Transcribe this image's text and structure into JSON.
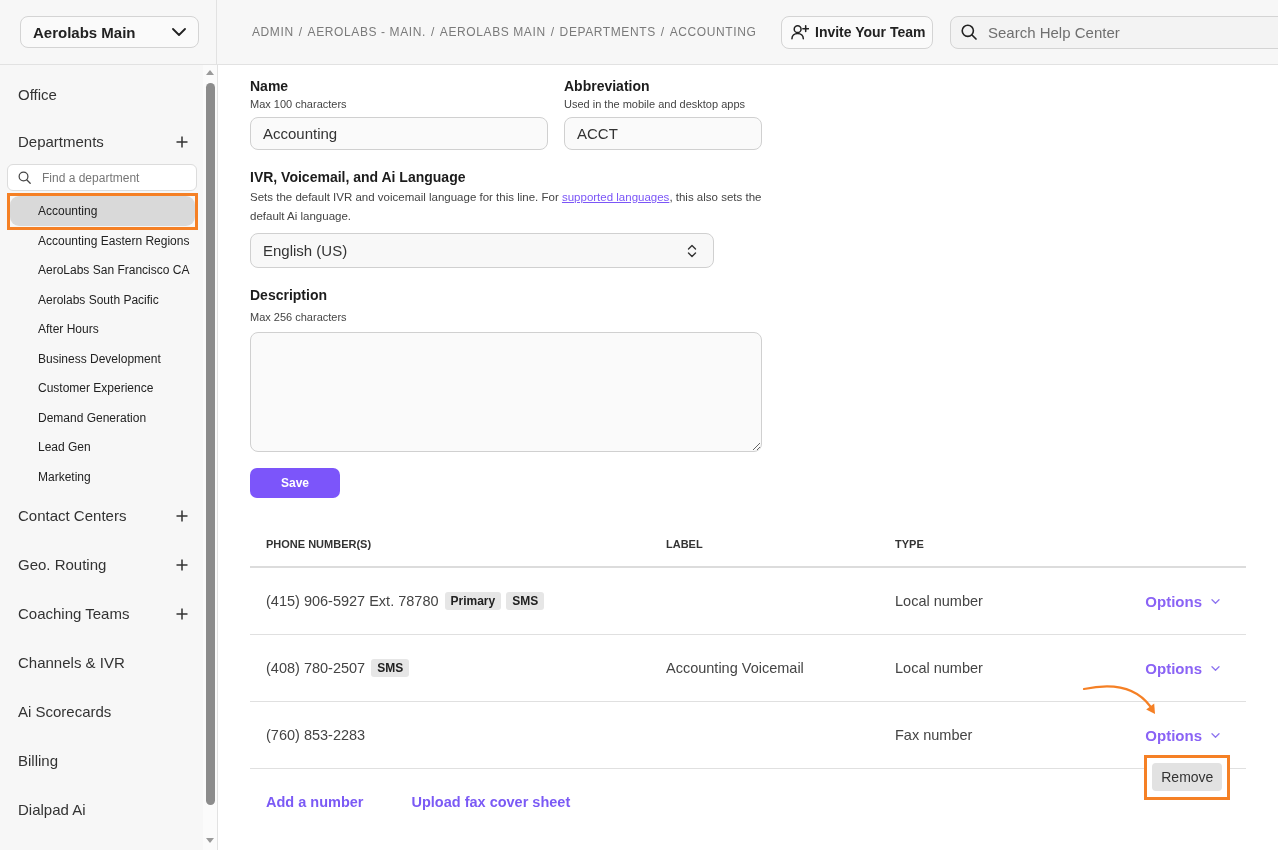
{
  "top_bar": {
    "org_switcher": "Aerolabs Main",
    "breadcrumb": [
      "ADMIN",
      "AEROLABS - MAIN.",
      "AEROLABS MAIN",
      "DEPARTMENTS",
      "ACCOUNTING"
    ],
    "breadcrumb_separator": "/",
    "invite_button": "Invite Your Team",
    "search": {
      "placeholder": "Search Help Center"
    }
  },
  "sidebar": {
    "sections": [
      {
        "label": "Office",
        "add_button": false
      },
      {
        "label": "Departments",
        "add_button": true,
        "search": {
          "placeholder": "Find a department"
        },
        "children": [
          {
            "label": "Accounting",
            "selected": true,
            "highlighted": true
          },
          {
            "label": "Accounting Eastern Regions",
            "selected": false,
            "highlighted": false
          },
          {
            "label": "AeroLabs San Francisco CA",
            "selected": false,
            "highlighted": false
          },
          {
            "label": "Aerolabs South Pacific",
            "selected": false,
            "highlighted": false
          },
          {
            "label": "After Hours",
            "selected": false,
            "highlighted": false
          },
          {
            "label": "Business Development",
            "selected": false,
            "highlighted": false
          },
          {
            "label": "Customer Experience",
            "selected": false,
            "highlighted": false
          },
          {
            "label": "Demand Generation",
            "selected": false,
            "highlighted": false
          },
          {
            "label": "Lead Gen",
            "selected": false,
            "highlighted": false
          },
          {
            "label": "Marketing",
            "selected": false,
            "highlighted": false
          }
        ]
      },
      {
        "label": "Contact Centers",
        "add_button": true
      },
      {
        "label": "Geo. Routing",
        "add_button": true
      },
      {
        "label": "Coaching Teams",
        "add_button": true
      },
      {
        "label": "Channels & IVR",
        "add_button": false
      },
      {
        "label": "Ai Scorecards",
        "add_button": false
      },
      {
        "label": "Billing",
        "add_button": false
      },
      {
        "label": "Dialpad Ai",
        "add_button": false
      }
    ]
  },
  "form": {
    "name": {
      "label": "Name",
      "hint": "Max 100 characters",
      "value": "Accounting"
    },
    "abbreviation": {
      "label": "Abbreviation",
      "hint": "Used in the mobile and desktop apps",
      "value": "ACCT"
    },
    "language": {
      "label": "IVR, Voicemail, and Ai Language",
      "description_before": "Sets the default IVR and voicemail language for this line. For ",
      "description_link": "supported languages",
      "description_after": ", this also sets the default Ai language.",
      "value": "English (US)"
    },
    "description": {
      "label": "Description",
      "hint": "Max 256 characters"
    },
    "save_button": "Save"
  },
  "table": {
    "columns": [
      "PHONE NUMBER(S)",
      "LABEL",
      "TYPE"
    ],
    "rows": [
      {
        "number": "(415) 906-5927 Ext. 78780",
        "badges": [
          "Primary",
          "SMS"
        ],
        "type": "Local number",
        "options": "Options",
        "options_open": false,
        "callout_arrow": false
      },
      {
        "number": "(408) 780-2507",
        "badges": [
          "SMS"
        ],
        "label": "Accounting Voicemail",
        "type": "Local number",
        "options": "Options",
        "options_open": false,
        "callout_arrow": false
      },
      {
        "number": "(760) 853-2283",
        "badges": [],
        "type": "Fax number",
        "options": "Options",
        "options_open": true,
        "callout_arrow": true
      }
    ],
    "options_menu": [
      {
        "label": "Remove",
        "highlighted": true
      }
    ],
    "footer_links": [
      "Add a number",
      "Upload fax cover sheet"
    ]
  }
}
